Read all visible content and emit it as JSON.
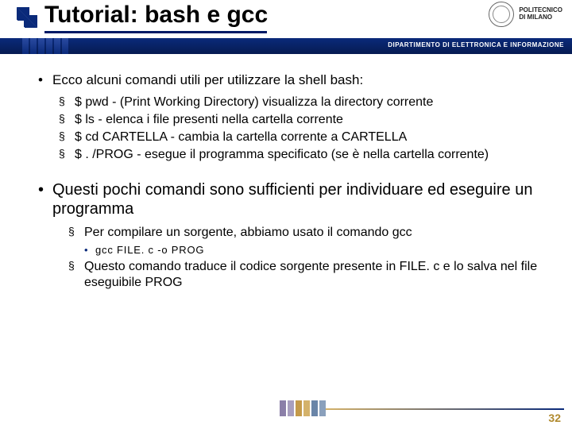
{
  "header": {
    "title": "Tutorial: bash e gcc",
    "logo_text": "POLITECNICO\nDI MILANO"
  },
  "bluebar": {
    "dept": "DIPARTIMENTO DI ELETTRONICA E INFORMAZIONE"
  },
  "content": {
    "p1": "Ecco alcuni comandi utili per utilizzare la shell bash:",
    "s1a": "$ pwd - (Print Working Directory) visualizza la directory corrente",
    "s1b": "$ ls - elenca i file presenti nella cartella corrente",
    "s1c": "$ cd CARTELLA - cambia la cartella corrente a CARTELLA",
    "s1d": "$ . /PROG - esegue il programma specificato (se è nella cartella corrente)",
    "p2": "Questi pochi comandi sono sufficienti per individuare ed eseguire un programma",
    "s2a": "Per compilare un sorgente, abbiamo usato il comando gcc",
    "s2a1": "gcc FILE. c -o PROG",
    "s2b": "Questo comando traduce il codice sorgente presente in FILE. c e lo salva nel file eseguibile PROG"
  },
  "footer": {
    "page": "32"
  }
}
